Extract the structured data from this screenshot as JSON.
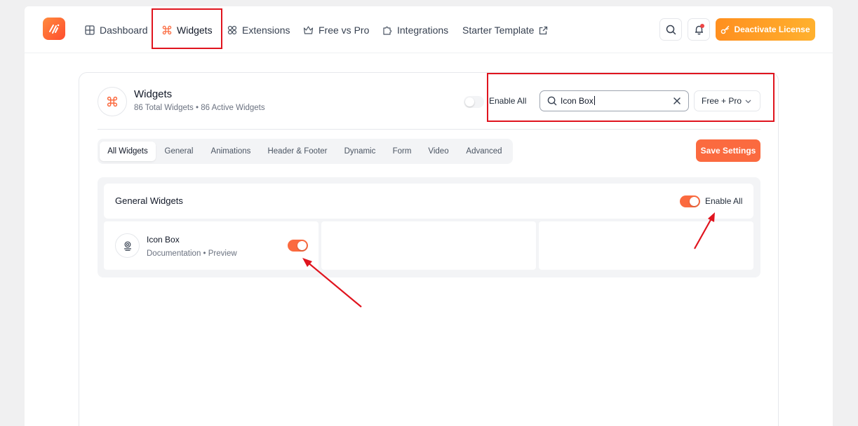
{
  "nav": {
    "items": [
      {
        "label": "Dashboard",
        "icon": "grid-icon"
      },
      {
        "label": "Widgets",
        "icon": "command-icon"
      },
      {
        "label": "Extensions",
        "icon": "extensions-icon"
      },
      {
        "label": "Free vs Pro",
        "icon": "crown-icon"
      },
      {
        "label": "Integrations",
        "icon": "puzzle-icon"
      },
      {
        "label": "Starter Template",
        "icon": "external-link-icon"
      }
    ],
    "deactivate_label": "Deactivate License"
  },
  "widgets_header": {
    "title": "Widgets",
    "subtitle": "86 Total Widgets • 86 Active Widgets",
    "enable_all_label": "Enable All",
    "enable_all_on": false,
    "search_value": "Icon Box",
    "filter_value": "Free + Pro"
  },
  "tabs": [
    "All Widgets",
    "General",
    "Animations",
    "Header & Footer",
    "Dynamic",
    "Form",
    "Video",
    "Advanced"
  ],
  "save_label": "Save Settings",
  "group": {
    "title": "General Widgets",
    "enable_all_label": "Enable All",
    "enable_all_on": true,
    "widgets": [
      {
        "name": "Icon Box",
        "links": "Documentation • Preview",
        "enabled": true
      }
    ]
  },
  "colors": {
    "accent": "#fb6a3f",
    "annotation": "#e0141e",
    "license_gradient_start": "#ff8f1f",
    "license_gradient_end": "#ffb12e"
  }
}
